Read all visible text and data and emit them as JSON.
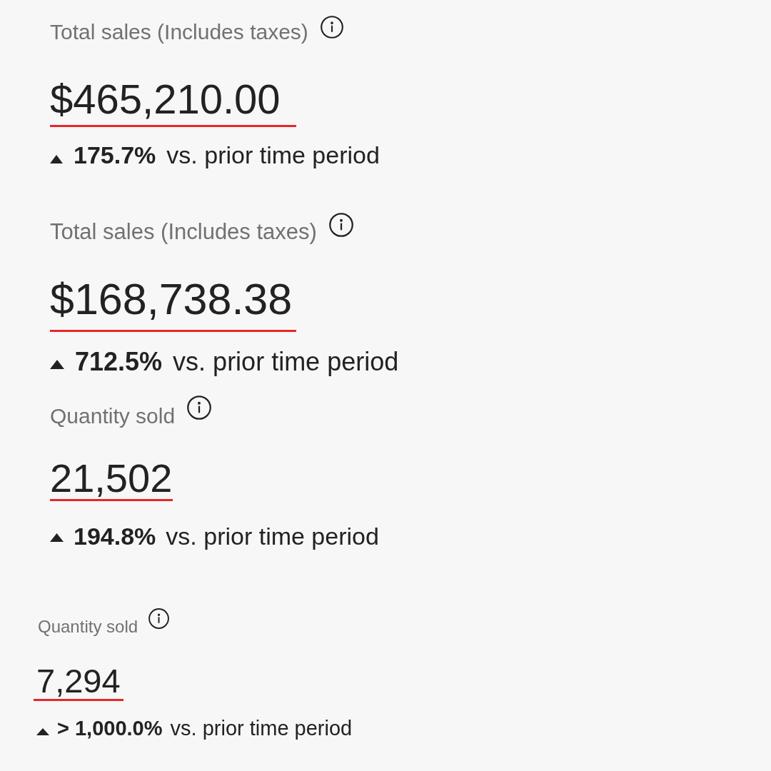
{
  "cards": [
    {
      "label": "Total sales (Includes taxes)",
      "value": "$465,210.00",
      "increase": true,
      "change": "175.7%",
      "comparison": "vs. prior time period"
    },
    {
      "label": "Total sales (Includes taxes)",
      "value": "$168,738.38",
      "increase": true,
      "change": "712.5%",
      "comparison": "vs. prior time period"
    },
    {
      "label": "Quantity sold",
      "value": "21,502",
      "increase": true,
      "change": "194.8%",
      "comparison": "vs. prior time period"
    },
    {
      "label": "Quantity sold",
      "value": "7,294",
      "increase": true,
      "change": "> 1,000.0%",
      "comparison": "vs. prior time period"
    }
  ]
}
